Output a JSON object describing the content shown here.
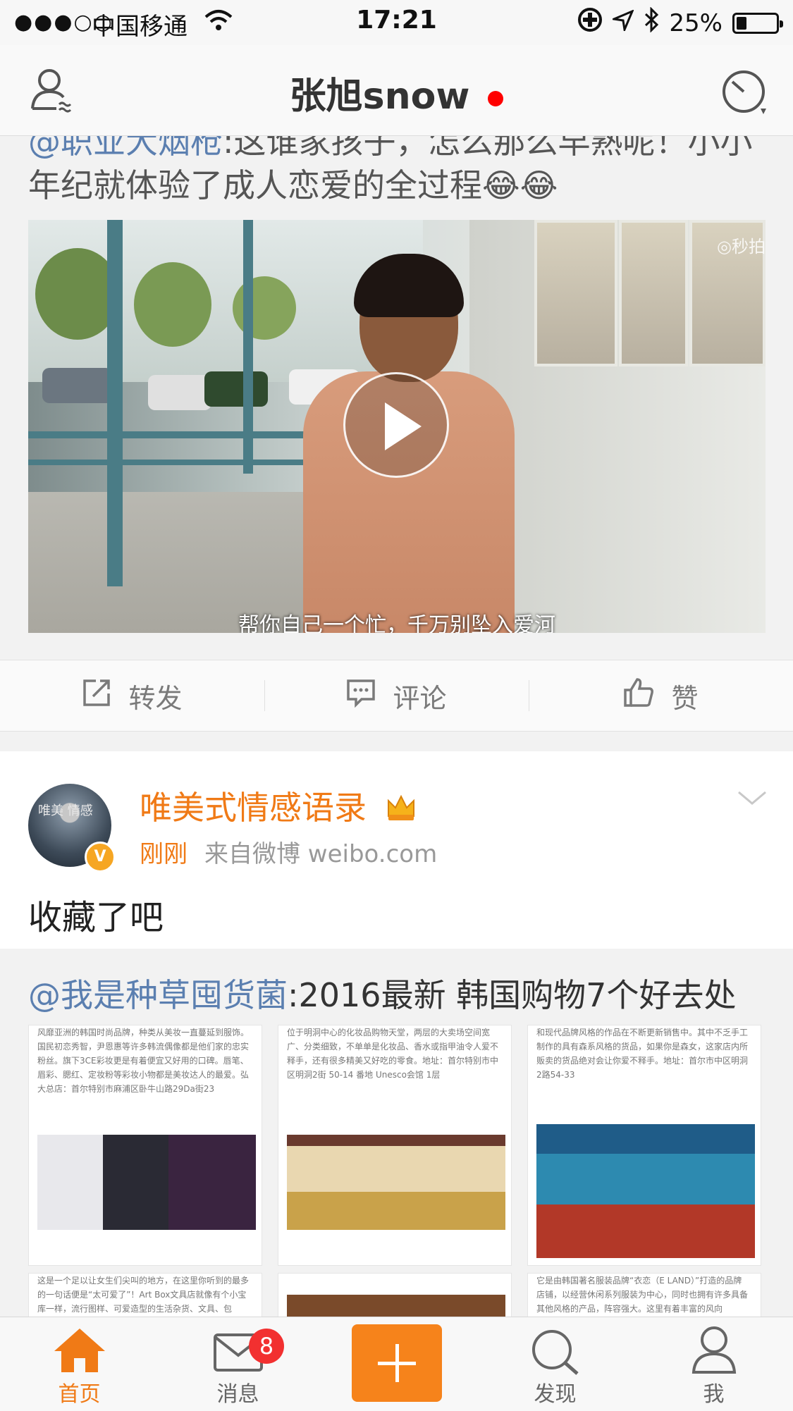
{
  "status_bar": {
    "signal": "●●●○○",
    "carrier": "中国移通",
    "time": "17:21",
    "battery": "25%",
    "battery_level": 0.25
  },
  "nav": {
    "title": "张旭snow",
    "has_unread_dot": true
  },
  "post1": {
    "repost_mention": "@职业大烟枪",
    "repost_text": ":这谁家孩子，怎么那么早熟呢！小小年纪就体验了成人恋爱的全过程😂😂",
    "video": {
      "subtitle": "帮你自己一个忙，千万别坠入爱河",
      "watermark": "◎秒拍"
    },
    "actions": {
      "repost": "转发",
      "comment": "评论",
      "like": "赞"
    }
  },
  "post2": {
    "author": "唯美式情感语录",
    "avatar_text": "唯美 情感",
    "verified_badge": "V",
    "time": "刚刚",
    "source": "来自微博 weibo.com",
    "text": "收藏了吧",
    "repost_mention": "@我是种草囤货菌",
    "repost_text": ":2016最新 韩国购物7个好去处",
    "images": [
      {
        "text": "风靡亚洲的韩国时尚品牌，种类从美妆一直蔓延到服饰。国民初恋秀智，尹恩惠等许多韩流偶像都是他们家的忠实粉丝。旗下3CE彩妆更是有着便宜又好用的口碑。唇笔、眉彩、腮红、定妆粉等彩妆小物都是美妆达人的最爱。弘大总店：首尔特别市麻浦区卧牛山路29Da街23"
      },
      {
        "text": "位于明洞中心的化妆品购物天堂，两层的大卖场空间宽广、分类细致，不单单是化妆品、香水或指甲油令人爱不释手，还有很多精美又好吃的零食。地址：首尔特别市中区明洞2街 50-14 番地 Unesco会馆 1层"
      },
      {
        "text": "和现代品牌风格的作品在不断更新销售中。其中不乏手工制作的具有森系风格的货品，如果你是森女，这家店内所贩卖的货品绝对会让你爱不释手。地址：首尔市中区明洞2路54-33"
      }
    ],
    "images_row2": [
      {
        "text": "这是一个足以让女生们尖叫的地方，在这里你听到的最多的一句话便是“太可爱了”！Art Box文具店就像有个小宝库一样，流行图样、可爱造型的生活杂货、文具、包"
      },
      {
        "text": ""
      },
      {
        "text": "它是由韩国著名服装品牌“衣恋（E LAND）”打造的品牌店铺，以经营休闲系列服装为中心，同时也拥有许多具备其他风格的产品，阵容强大。这里有着丰富的风向"
      }
    ]
  },
  "tabbar": {
    "home": "首页",
    "messages": "消息",
    "messages_badge": "8",
    "discover": "发现",
    "me": "我"
  },
  "colors": {
    "accent": "#f07a16",
    "mention": "#5b7fb0",
    "badge": "#f23030",
    "compose": "#f6831b"
  }
}
